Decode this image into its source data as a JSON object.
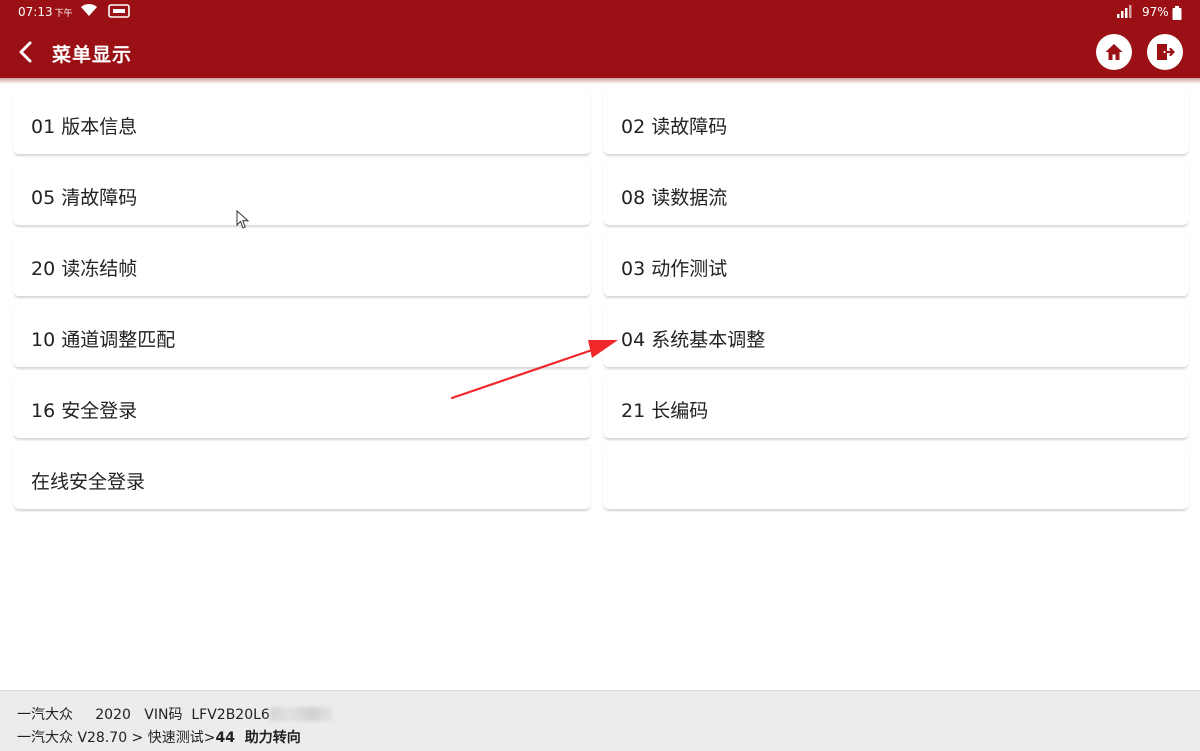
{
  "status_bar": {
    "time": "07:13",
    "ampm": "下午",
    "battery": "97%",
    "icons": [
      "wifi-icon",
      "message-icon",
      "signal-icon",
      "battery-icon"
    ]
  },
  "header": {
    "title": "菜单显示",
    "icons": [
      "back-arrow-icon",
      "home-icon",
      "exit-icon"
    ]
  },
  "menu": {
    "items": [
      {
        "label": "01 版本信息"
      },
      {
        "label": "02 读故障码"
      },
      {
        "label": "05 清故障码"
      },
      {
        "label": "08 读数据流"
      },
      {
        "label": "20 读冻结帧"
      },
      {
        "label": "03 动作测试"
      },
      {
        "label": "10 通道调整匹配"
      },
      {
        "label": "04 系统基本调整"
      },
      {
        "label": "16 安全登录"
      },
      {
        "label": "21 长编码"
      },
      {
        "label": "在线安全登录"
      },
      {
        "label": ""
      }
    ]
  },
  "footer": {
    "brand": "一汽大众",
    "year": "2020",
    "vin_label": "VIN码",
    "vin_value": "LFV2B20L6",
    "path_prefix": "一汽大众 V28.70 > 快速测试>",
    "path_current": "44  助力转向"
  },
  "colors": {
    "header_bg": "#9a1014",
    "annotation_arrow": "#f0282a"
  }
}
